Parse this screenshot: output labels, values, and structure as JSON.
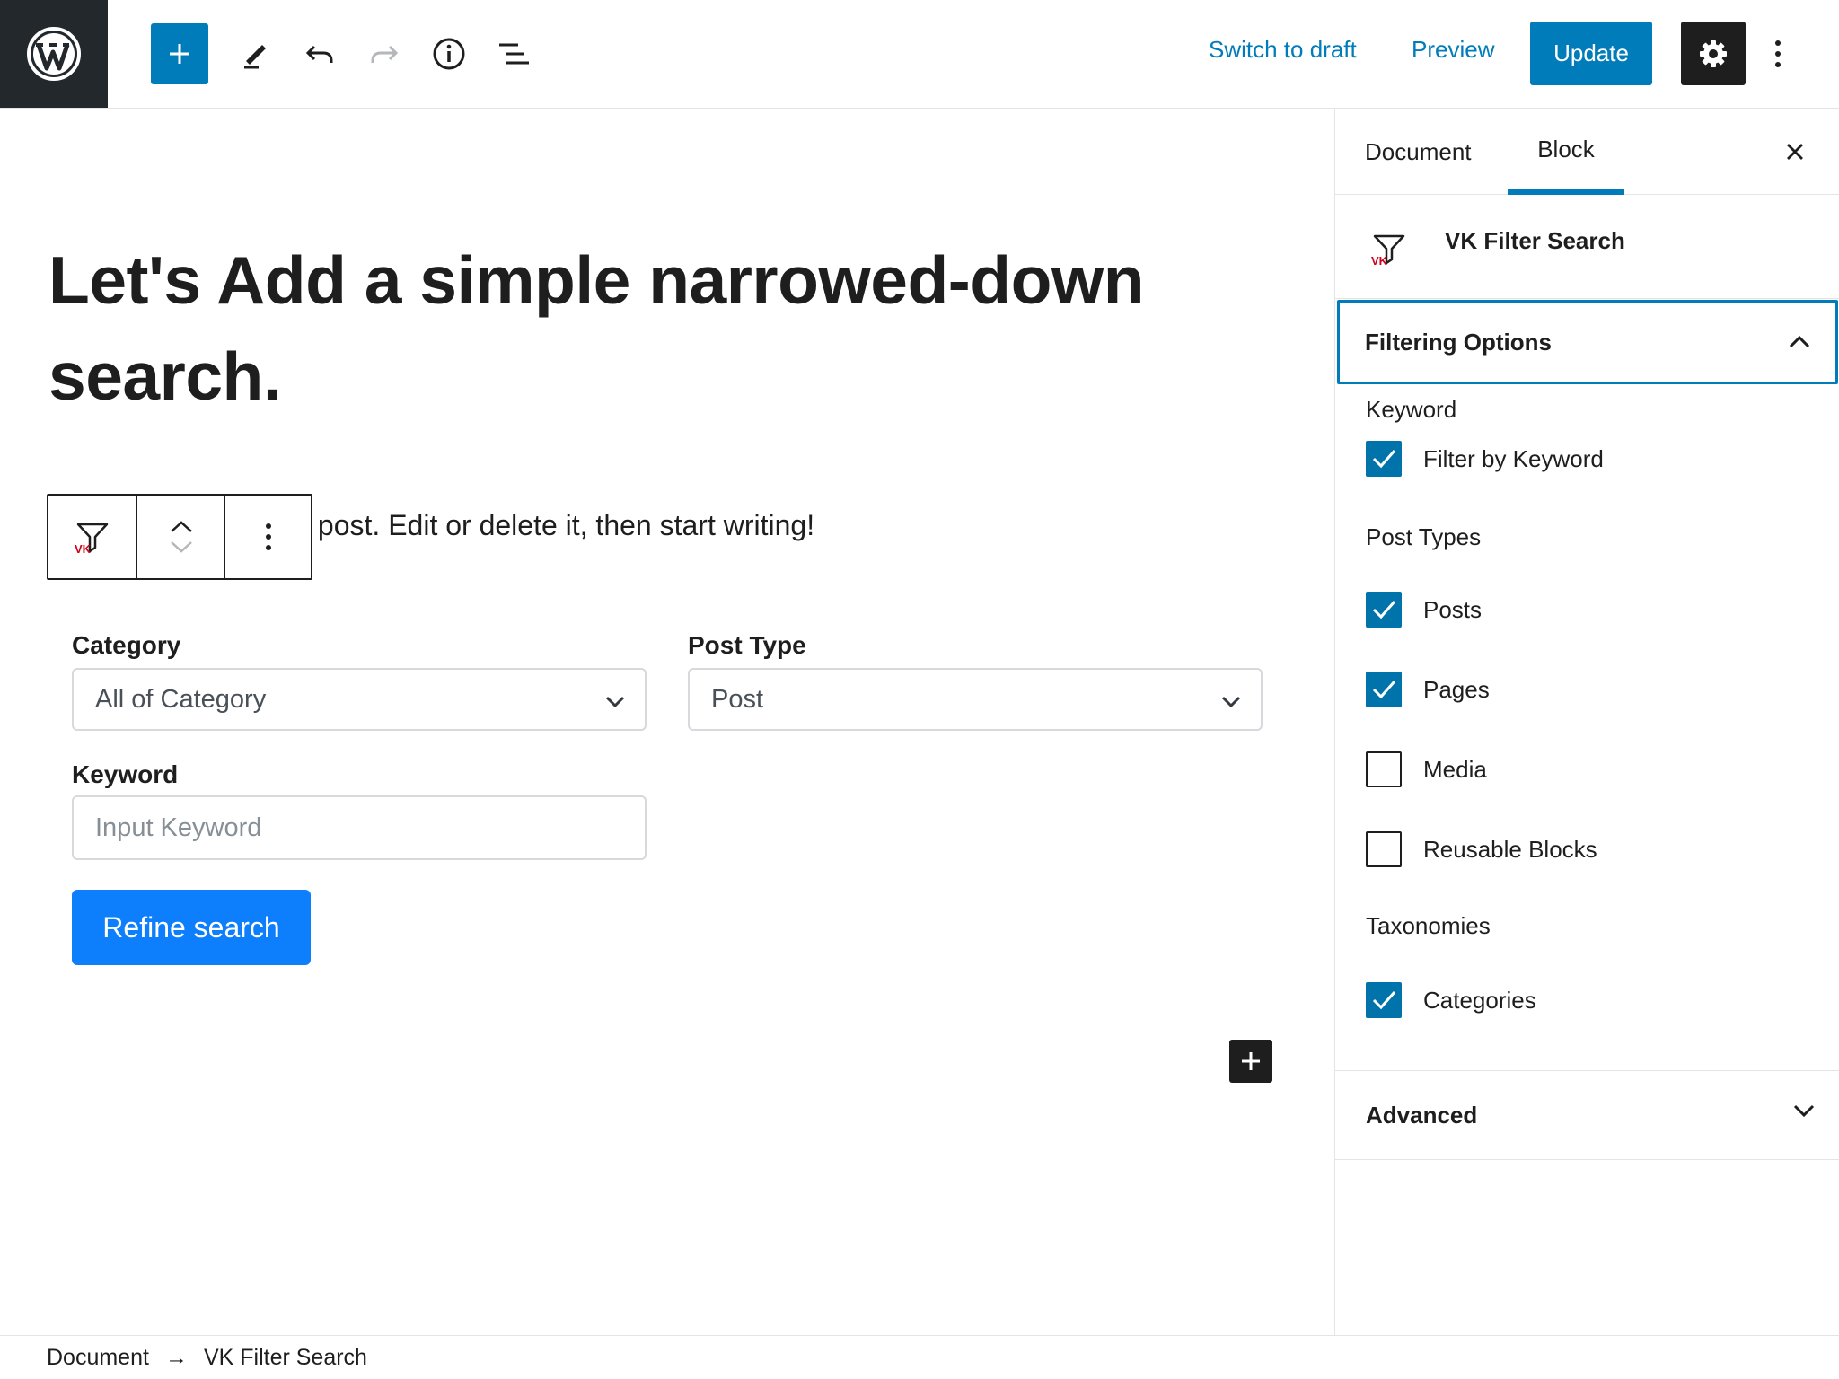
{
  "toolbar": {
    "switch_to_draft": "Switch to draft",
    "preview": "Preview",
    "update": "Update",
    "icons": [
      "wordpress-logo-icon",
      "plus-icon",
      "pencil-icon",
      "undo-icon",
      "redo-icon",
      "info-icon",
      "list-view-icon",
      "gear-icon",
      "more-vertical-icon"
    ]
  },
  "editor": {
    "post_title": "Let's Add a simple narrowed-down search.",
    "paragraph": "ess. This is your first post. Edit or delete it, then start writing!",
    "block": {
      "category_label": "Category",
      "category_value": "All of Category",
      "post_type_label": "Post Type",
      "post_type_value": "Post",
      "keyword_label": "Keyword",
      "keyword_placeholder": "Input Keyword",
      "refine_button": "Refine search"
    }
  },
  "sidebar": {
    "tabs": [
      {
        "label": "Document",
        "active": false
      },
      {
        "label": "Block",
        "active": true
      }
    ],
    "block_name": "VK Filter Search",
    "panel_title": "Filtering Options",
    "keyword_section": "Keyword",
    "filter_by_keyword": {
      "label": "Filter by Keyword",
      "checked": true
    },
    "post_types_section": "Post Types",
    "post_types": [
      {
        "label": "Posts",
        "checked": true
      },
      {
        "label": "Pages",
        "checked": true
      },
      {
        "label": "Media",
        "checked": false
      },
      {
        "label": "Reusable Blocks",
        "checked": false
      }
    ],
    "taxonomies_section": "Taxonomies",
    "taxonomies": [
      {
        "label": "Categories",
        "checked": true
      }
    ],
    "advanced": "Advanced"
  },
  "footer": {
    "breadcrumb": [
      "Document",
      "VK Filter Search"
    ],
    "separator": "→"
  },
  "colors": {
    "accent": "#007cba",
    "refine_button": "#0d7efc",
    "checkbox": "#0073aa",
    "dark": "#1e1e1e"
  }
}
